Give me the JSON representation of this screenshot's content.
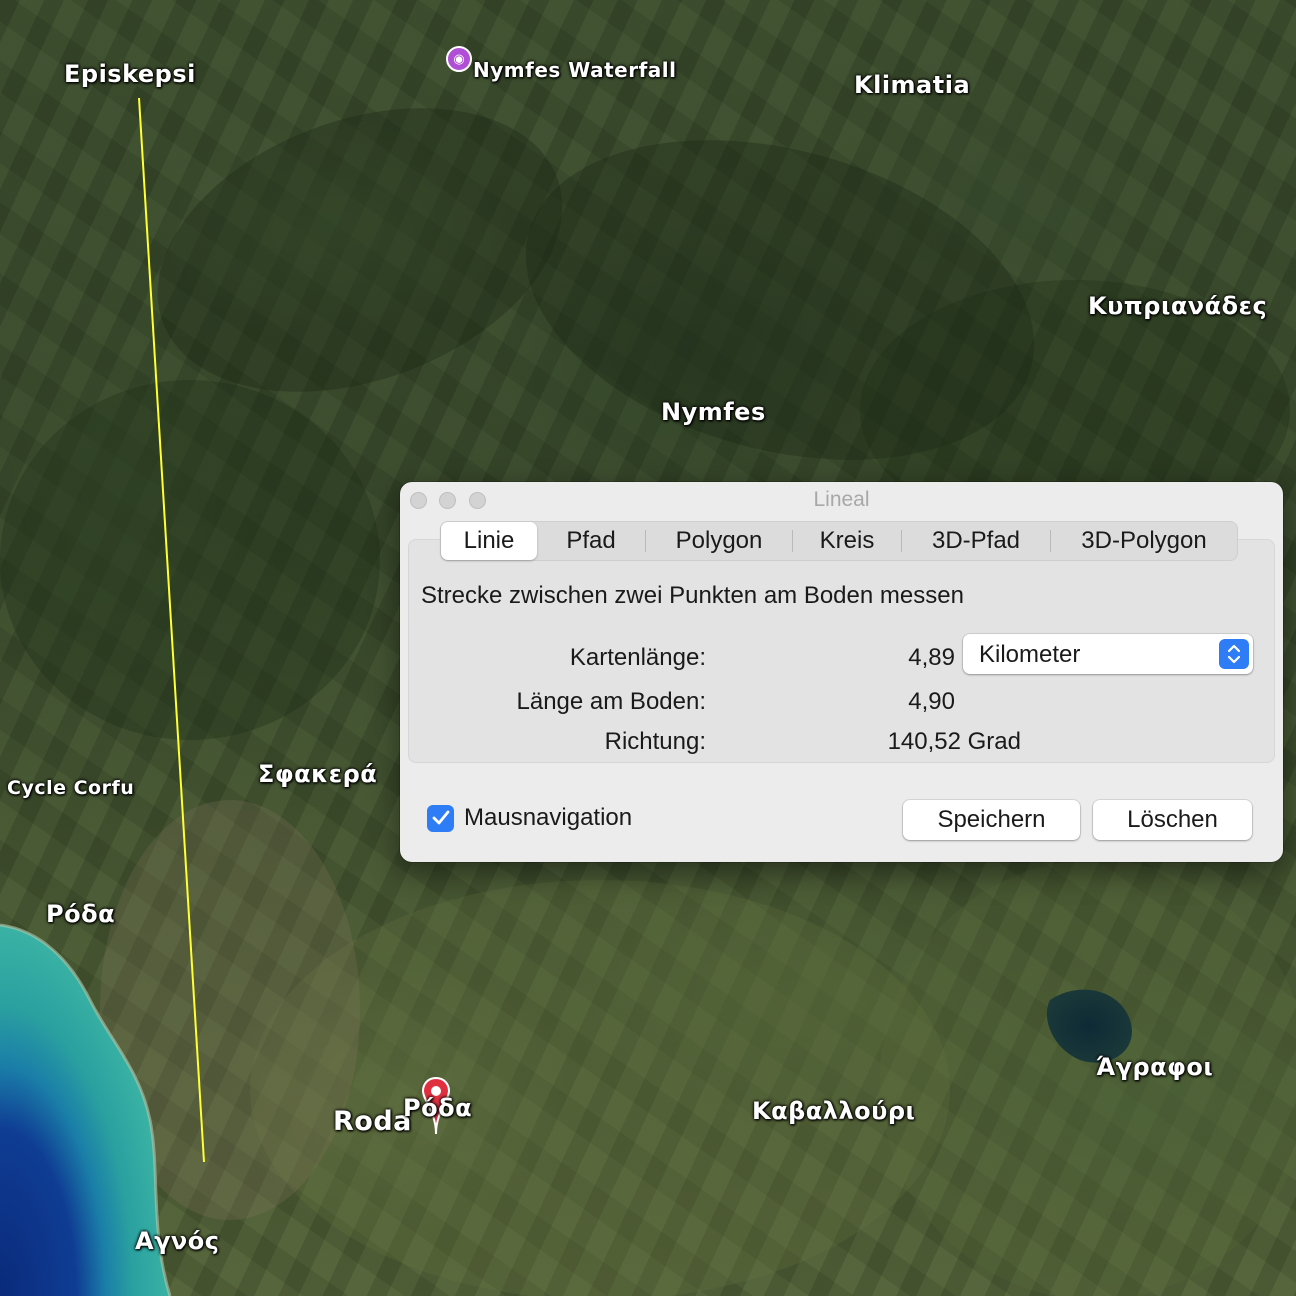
{
  "map": {
    "labels": {
      "episkepsi": "Episkepsi",
      "nymfes_waterfall": "Nymfes Waterfall",
      "klimatia": "Klimatia",
      "kyprianades": "Κυπριανάδες",
      "nymfes": "Nymfes",
      "sfakera": "Σφακερά",
      "cycle_corfu": "Cycle Corfu",
      "roda_gr_west": "Ρόδα",
      "roda": "Roda",
      "roda_gr_pin": "Ρόδα",
      "kavallouri": "Καβαλλούρι",
      "agrafoi": "Άγραφοι",
      "agnos": "Αγνός"
    },
    "measure_line_color": "#ffff33",
    "icons": {
      "poi": "camera-poi-icon",
      "pin": "map-pin-icon"
    }
  },
  "dialog": {
    "title": "Lineal",
    "tabs": [
      "Linie",
      "Pfad",
      "Polygon",
      "Kreis",
      "3D-Pfad",
      "3D-Polygon"
    ],
    "selected_tab": "Linie",
    "description": "Strecke zwischen zwei Punkten am Boden messen",
    "rows": {
      "map_length": {
        "label": "Kartenlänge:",
        "value": "4,89"
      },
      "ground_length": {
        "label": "Länge am Boden:",
        "value": "4,90"
      },
      "heading": {
        "label": "Richtung:",
        "value": "140,52 Grad"
      }
    },
    "unit": "Kilometer",
    "mouse_navigation": {
      "label": "Mausnavigation",
      "checked": true
    },
    "buttons": {
      "save": "Speichern",
      "delete": "Löschen"
    },
    "accent_color": "#2e7cf6"
  }
}
